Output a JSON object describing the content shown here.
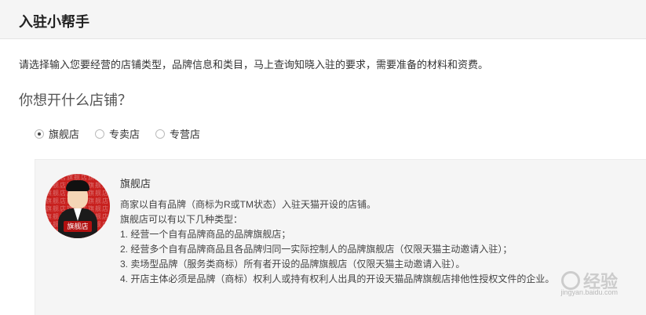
{
  "header": {
    "title": "入驻小帮手"
  },
  "intro": "请选择输入您要经营的店铺类型，品牌信息和类目，马上查询知晓入驻的要求，需要准备的材料和资费。",
  "question": "你想开什么店铺？",
  "store_types": [
    {
      "label": "旗舰店",
      "checked": true
    },
    {
      "label": "专卖店",
      "checked": false
    },
    {
      "label": "专营店",
      "checked": false
    }
  ],
  "detail": {
    "avatar_tag": "旗舰店",
    "avatar_pattern": "旗舰店旗舰店旗舰店旗舰店旗舰店旗舰店旗舰店旗舰店旗舰店旗舰店旗舰店旗舰店旗舰店旗舰店旗舰店旗舰店旗舰店旗舰店旗舰店旗舰店旗舰店旗舰店旗舰店",
    "title": "旗舰店",
    "lines": [
      "商家以自有品牌（商标为R或TM状态）入驻天猫开设的店铺。",
      "旗舰店可以有以下几种类型：",
      "1. 经营一个自有品牌商品的品牌旗舰店；",
      "2. 经营多个自有品牌商品且各品牌归同一实际控制人的品牌旗舰店（仅限天猫主动邀请入驻）；",
      "3. 卖场型品牌（服务类商标）所有者开设的品牌旗舰店（仅限天猫主动邀请入驻）。",
      "4. 开店主体必须是品牌（商标）权利人或持有权利人出具的开设天猫品牌旗舰店排他性授权文件的企业。"
    ]
  },
  "watermark": {
    "text": "经验",
    "sub": "jingyan.baidu.com"
  }
}
